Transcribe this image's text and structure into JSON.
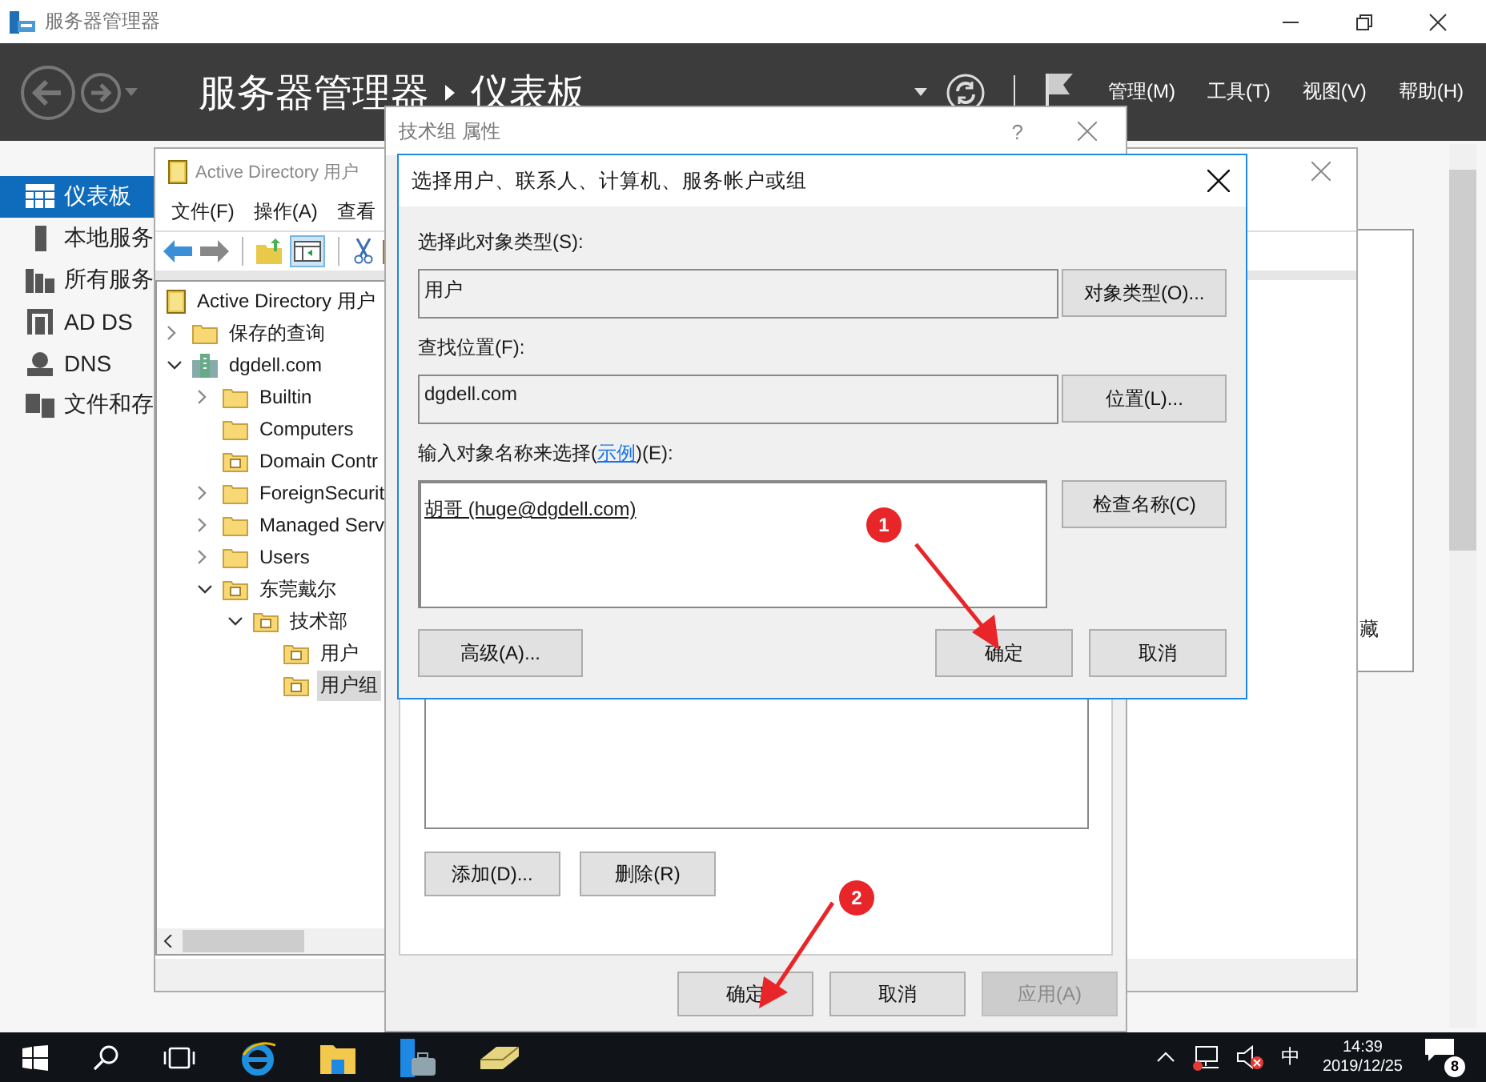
{
  "window": {
    "title": "服务器管理器"
  },
  "header": {
    "breadcrumb": [
      "服务器管理器",
      "仪表板"
    ],
    "menus": [
      "管理(M)",
      "工具(T)",
      "视图(V)",
      "帮助(H)"
    ]
  },
  "sidebar": {
    "items": [
      {
        "label": "仪表板",
        "kind": "dashboard",
        "selected": true
      },
      {
        "label": "本地服务",
        "kind": "server",
        "selected": false
      },
      {
        "label": "所有服务",
        "kind": "servers",
        "selected": false
      },
      {
        "label": "AD DS",
        "kind": "adds",
        "selected": false
      },
      {
        "label": "DNS",
        "kind": "dns",
        "selected": false
      },
      {
        "label": "文件和存",
        "kind": "files",
        "selected": false
      }
    ]
  },
  "background_panel": {
    "text": "藏"
  },
  "ad_window": {
    "title": "Active Directory 用户",
    "menus": [
      "文件(F)",
      "操作(A)",
      "查看"
    ],
    "tree": [
      {
        "label": "Active Directory 用户",
        "kind": "root",
        "selected": false,
        "children": [
          {
            "label": "保存的查询",
            "kind": "folder",
            "expanded": false,
            "selected": false
          },
          {
            "label": "dgdell.com",
            "kind": "domain",
            "expanded": true,
            "selected": false,
            "children": [
              {
                "label": "Builtin",
                "kind": "folder",
                "expanded": false,
                "selected": false
              },
              {
                "label": "Computers",
                "kind": "folder",
                "selected": false
              },
              {
                "label": "Domain Contr",
                "kind": "ou",
                "selected": false
              },
              {
                "label": "ForeignSecurit",
                "kind": "folder",
                "expanded": false,
                "selected": false
              },
              {
                "label": "Managed Serv",
                "kind": "folder",
                "expanded": false,
                "selected": false
              },
              {
                "label": "Users",
                "kind": "folder",
                "expanded": false,
                "selected": false
              },
              {
                "label": "东莞戴尔",
                "kind": "ou",
                "expanded": true,
                "selected": false,
                "children": [
                  {
                    "label": "技术部",
                    "kind": "ou",
                    "expanded": true,
                    "selected": false,
                    "children": [
                      {
                        "label": "用户",
                        "kind": "ou",
                        "selected": false
                      },
                      {
                        "label": "用户组",
                        "kind": "ou",
                        "selected": true
                      }
                    ]
                  }
                ]
              }
            ]
          }
        ]
      }
    ]
  },
  "properties_dialog": {
    "title": "技术组 属性",
    "help": "?",
    "list_buttons": [
      "添加(D)...",
      "删除(R)"
    ],
    "buttons": [
      {
        "label": "确定",
        "disabled": false
      },
      {
        "label": "取消",
        "disabled": false
      },
      {
        "label": "应用(A)",
        "disabled": true
      }
    ]
  },
  "select_dialog": {
    "title": "选择用户、联系人、计算机、服务帐户或组",
    "object_type": {
      "label": "选择此对象类型(S):",
      "value": "用户",
      "button": "对象类型(O)..."
    },
    "location": {
      "label": "查找位置(F):",
      "value": "dgdell.com",
      "button": "位置(L)..."
    },
    "names": {
      "label_before": "输入对象名称来选择(",
      "link": "示例",
      "label_after": ")(E):",
      "value": "胡哥 (huge@dgdell.com)",
      "button": "检查名称(C)"
    },
    "buttons": [
      "高级(A)...",
      "确定",
      "取消"
    ]
  },
  "annotations": [
    {
      "number": "1"
    },
    {
      "number": "2"
    }
  ],
  "taskbar": {
    "ime": "中",
    "time": "14:39",
    "date": "2019/12/25",
    "notifications": "8"
  }
}
